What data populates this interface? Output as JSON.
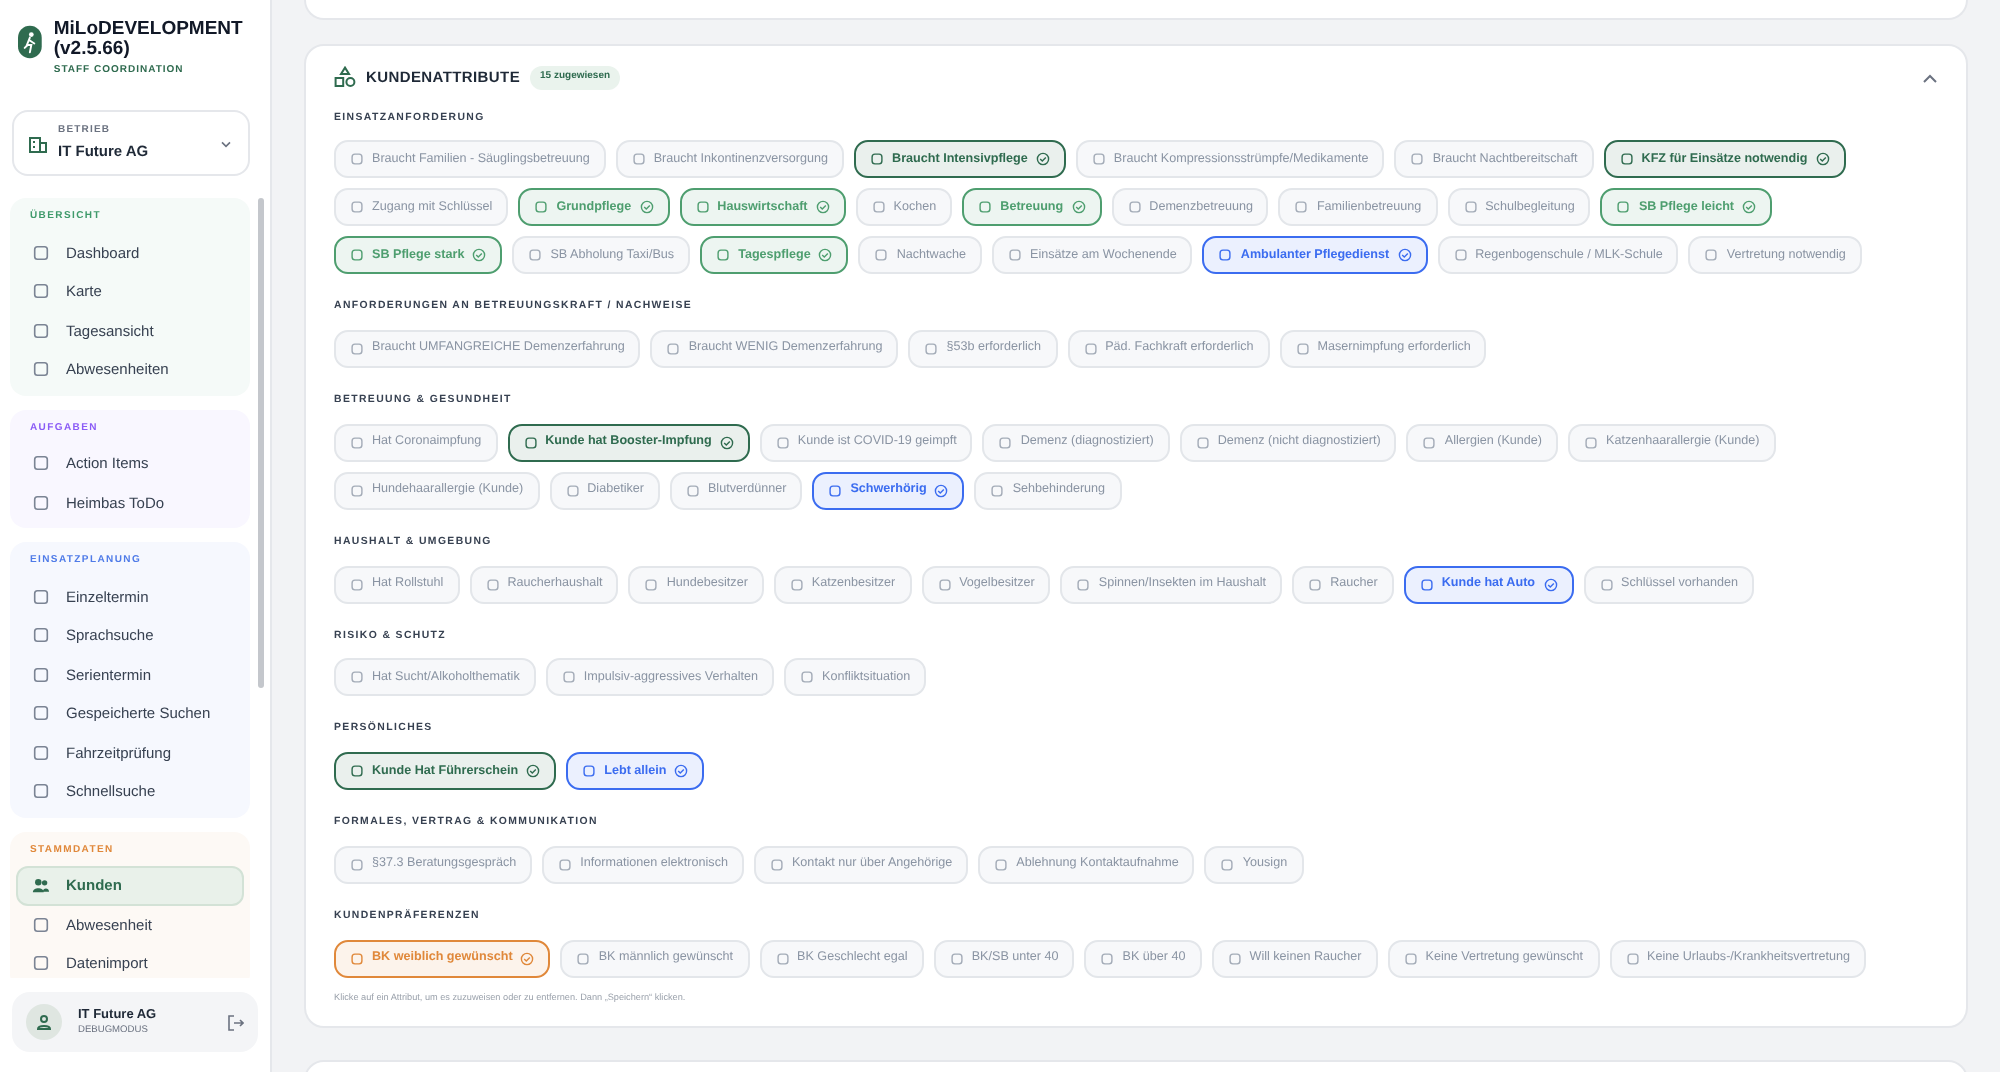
{
  "app": {
    "title": "MiLoDEVELOPMENT (v2.5.66)",
    "subtitle": "STAFF COORDINATION"
  },
  "company_select": {
    "label": "BETRIEB",
    "value": "IT Future AG"
  },
  "nav_groups": [
    {
      "title": "ÜBERSICHT",
      "color": "#3f9a6b",
      "items": [
        {
          "label": "Dashboard",
          "selected": false
        },
        {
          "label": "Karte",
          "selected": false
        },
        {
          "label": "Tagesansicht",
          "selected": false
        },
        {
          "label": "Abwesenheiten",
          "selected": false
        }
      ]
    },
    {
      "title": "AUFGABEN",
      "color": "#8b5cf6",
      "items": [
        {
          "label": "Action Items",
          "selected": false
        },
        {
          "label": "Heimbas ToDo",
          "selected": false
        }
      ]
    },
    {
      "title": "EINSATZPLANUNG",
      "color": "#4f7be8",
      "items": [
        {
          "label": "Einzeltermin",
          "selected": false
        },
        {
          "label": "Sprachsuche",
          "selected": false
        },
        {
          "label": "Serientermin",
          "selected": false
        },
        {
          "label": "Gespeicherte Suchen",
          "selected": false
        },
        {
          "label": "Fahrzeitprüfung",
          "selected": false
        },
        {
          "label": "Schnellsuche",
          "selected": false
        }
      ]
    },
    {
      "title": "STAMMDATEN",
      "color": "#e0883a",
      "items": [
        {
          "label": "Kunden",
          "selected": true
        },
        {
          "label": "Abwesenheit",
          "selected": false
        },
        {
          "label": "Datenimport",
          "selected": false
        }
      ]
    }
  ],
  "user": {
    "name": "IT Future AG",
    "mode": "DEBUGMODUS"
  },
  "panel": {
    "title": "KUNDENATTRIBUTE",
    "badge": "15 zugewiesen",
    "expanded": true,
    "groups": [
      {
        "title": "EINSATZANFORDERUNG",
        "chips": [
          {
            "label": "Braucht Familien - Säuglingsbetreuung",
            "selected": false
          },
          {
            "label": "Braucht Inkontinenzversorgung",
            "selected": false
          },
          {
            "label": "Braucht Intensivpflege",
            "selected": true,
            "color": "#2f6b4f"
          },
          {
            "label": "Braucht Kompressionsstrümpfe/Medikamente",
            "selected": false
          },
          {
            "label": "Braucht Nachtbereitschaft",
            "selected": false
          },
          {
            "label": "KFZ für Einsätze notwendig",
            "selected": true,
            "color": "#2f6b4f"
          },
          {
            "label": "Zugang mit Schlüssel",
            "selected": false
          },
          {
            "label": "Grundpflege",
            "selected": true,
            "color": "#4e9e6f"
          },
          {
            "label": "Hauswirtschaft",
            "selected": true,
            "color": "#4e9e6f"
          },
          {
            "label": "Kochen",
            "selected": false
          },
          {
            "label": "Betreuung",
            "selected": true,
            "color": "#4e9e6f"
          },
          {
            "label": "Demenzbetreuung",
            "selected": false
          },
          {
            "label": "Familienbetreuung",
            "selected": false
          },
          {
            "label": "Schulbegleitung",
            "selected": false
          },
          {
            "label": "SB Pflege leicht",
            "selected": true,
            "color": "#4e9e6f"
          },
          {
            "label": "SB Pflege stark",
            "selected": true,
            "color": "#4e9e6f"
          },
          {
            "label": "SB Abholung Taxi/Bus",
            "selected": false
          },
          {
            "label": "Tagespflege",
            "selected": true,
            "color": "#4e9e6f"
          },
          {
            "label": "Nachtwache",
            "selected": false
          },
          {
            "label": "Einsätze am Wochenende",
            "selected": false
          },
          {
            "label": "Ambulanter Pflegedienst",
            "selected": true,
            "color": "#3b6cf0"
          },
          {
            "label": "Regenbogenschule / MLK-Schule",
            "selected": false
          },
          {
            "label": "Vertretung notwendig",
            "selected": false
          }
        ]
      },
      {
        "title": "ANFORDERUNGEN AN BETREUUNGSKRAFT / NACHWEISE",
        "chips": [
          {
            "label": "Braucht UMFANGREICHE Demenzerfahrung",
            "selected": false
          },
          {
            "label": "Braucht WENIG Demenzerfahrung",
            "selected": false
          },
          {
            "label": "§53b erforderlich",
            "selected": false
          },
          {
            "label": "Päd. Fachkraft erforderlich",
            "selected": false
          },
          {
            "label": "Masernimpfung erforderlich",
            "selected": false
          }
        ]
      },
      {
        "title": "BETREUUNG & GESUNDHEIT",
        "chips": [
          {
            "label": "Hat Coronaimpfung",
            "selected": false
          },
          {
            "label": "Kunde hat Booster-Impfung",
            "selected": true,
            "color": "#2f6b4f"
          },
          {
            "label": "Kunde ist COVID-19 geimpft",
            "selected": false
          },
          {
            "label": "Demenz (diagnostiziert)",
            "selected": false
          },
          {
            "label": "Demenz (nicht diagnostiziert)",
            "selected": false
          },
          {
            "label": "Allergien (Kunde)",
            "selected": false
          },
          {
            "label": "Katzenhaarallergie (Kunde)",
            "selected": false
          },
          {
            "label": "Hundehaarallergie (Kunde)",
            "selected": false
          },
          {
            "label": "Diabetiker",
            "selected": false
          },
          {
            "label": "Blutverdünner",
            "selected": false
          },
          {
            "label": "Schwerhörig",
            "selected": true,
            "color": "#3b6cf0"
          },
          {
            "label": "Sehbehinderung",
            "selected": false
          }
        ]
      },
      {
        "title": "HAUSHALT & UMGEBUNG",
        "chips": [
          {
            "label": "Hat Rollstuhl",
            "selected": false
          },
          {
            "label": "Raucherhaushalt",
            "selected": false
          },
          {
            "label": "Hundebesitzer",
            "selected": false
          },
          {
            "label": "Katzenbesitzer",
            "selected": false
          },
          {
            "label": "Vogelbesitzer",
            "selected": false
          },
          {
            "label": "Spinnen/Insekten im Haushalt",
            "selected": false
          },
          {
            "label": "Raucher",
            "selected": false
          },
          {
            "label": "Kunde hat Auto",
            "selected": true,
            "color": "#3b6cf0"
          },
          {
            "label": "Schlüssel vorhanden",
            "selected": false
          }
        ]
      },
      {
        "title": "RISIKO & SCHUTZ",
        "chips": [
          {
            "label": "Hat Sucht/Alkoholthematik",
            "selected": false
          },
          {
            "label": "Impulsiv-aggressives Verhalten",
            "selected": false
          },
          {
            "label": "Konfliktsituation",
            "selected": false
          }
        ]
      },
      {
        "title": "PERSÖNLICHES",
        "chips": [
          {
            "label": "Kunde Hat Führerschein",
            "selected": true,
            "color": "#2f6b4f"
          },
          {
            "label": "Lebt allein",
            "selected": true,
            "color": "#3b6cf0"
          }
        ]
      },
      {
        "title": "FORMALES, VERTRAG & KOMMUNIKATION",
        "chips": [
          {
            "label": "§37.3 Beratungsgespräch",
            "selected": false
          },
          {
            "label": "Informationen elektronisch",
            "selected": false
          },
          {
            "label": "Kontakt nur über Angehörige",
            "selected": false
          },
          {
            "label": "Ablehnung Kontaktaufnahme",
            "selected": false
          },
          {
            "label": "Yousign",
            "selected": false
          }
        ]
      },
      {
        "title": "KUNDENPRÄFERENZEN",
        "chips": [
          {
            "label": "BK weiblich gewünscht",
            "selected": true,
            "color": "#e0883a"
          },
          {
            "label": "BK männlich gewünscht",
            "selected": false
          },
          {
            "label": "BK Geschlecht egal",
            "selected": false
          },
          {
            "label": "BK/SB unter 40",
            "selected": false
          },
          {
            "label": "BK über 40",
            "selected": false
          },
          {
            "label": "Will keinen Raucher",
            "selected": false
          },
          {
            "label": "Keine Vertretung gewünscht",
            "selected": false
          },
          {
            "label": "Keine Urlaubs-/Krankheitsvertretung",
            "selected": false
          }
        ]
      }
    ],
    "hint": "Klicke auf ein Attribut, um es zuzuweisen oder zu entfernen. Dann „Speichern“ klicken."
  }
}
